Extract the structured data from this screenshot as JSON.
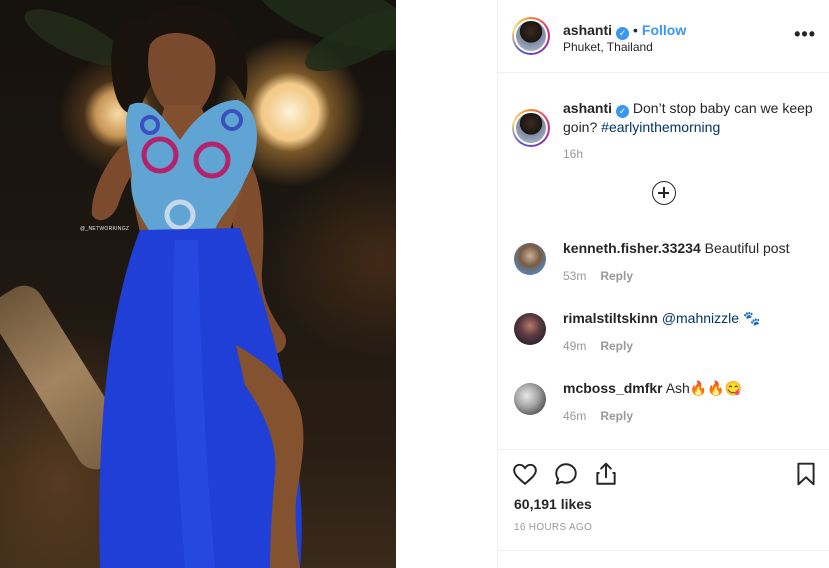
{
  "photo": {
    "watermark": "@_NETWORKINGZ"
  },
  "header": {
    "username": "ashanti",
    "verified_mark": "✓",
    "separator": "•",
    "follow_label": "Follow",
    "location": "Phuket, Thailand",
    "more_label": "•••"
  },
  "caption": {
    "username": "ashanti",
    "text": "Don’t stop baby can we keep goin?",
    "hashtag": "#earlyinthemorning",
    "age": "16h"
  },
  "comments": [
    {
      "username": "kenneth.fisher.33234",
      "text": "Beautiful post",
      "age": "53m",
      "reply_label": "Reply"
    },
    {
      "username": "rimalstiltskinn",
      "mention": "@mahnizzle",
      "emoji": "🐾",
      "age": "49m",
      "reply_label": "Reply"
    },
    {
      "username": "mcboss_dmfkr",
      "text": "Ash🔥🔥😋",
      "age": "46m",
      "reply_label": "Reply"
    }
  ],
  "actions": {
    "likes": "60,191 likes",
    "timestamp": "16 HOURS AGO"
  },
  "icons": {
    "like": "heart-icon",
    "comment": "comment-icon",
    "share": "share-icon",
    "save": "bookmark-icon",
    "load_more": "plus-circle-icon"
  },
  "colors": {
    "accent": "#3897f0",
    "text": "#262626",
    "muted": "#999999",
    "dress": "#1f3fd6"
  }
}
